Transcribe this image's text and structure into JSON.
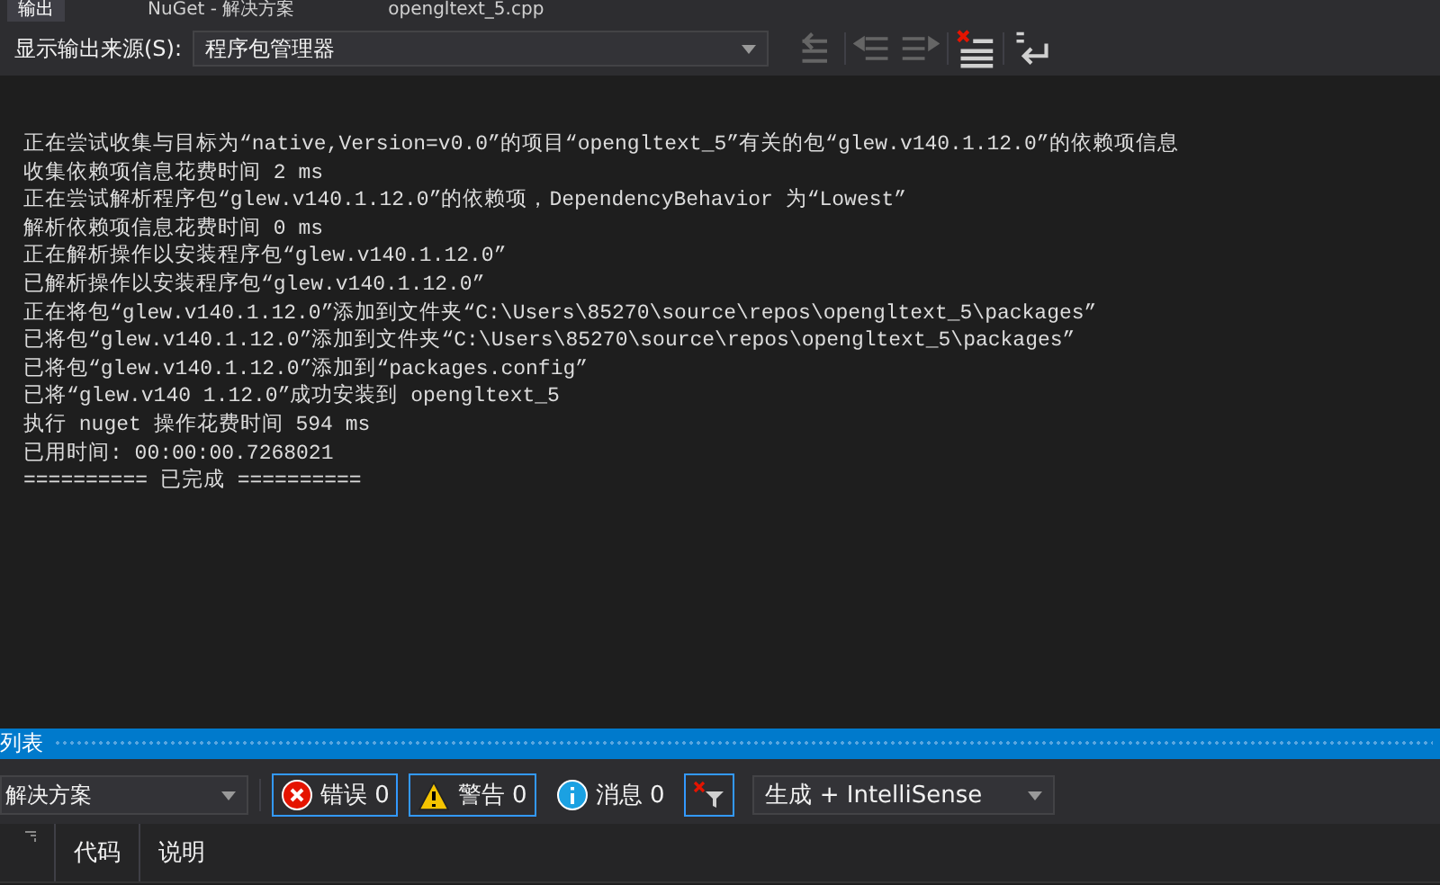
{
  "tabs": [
    {
      "label": "输出",
      "selected": true
    },
    {
      "label": "NuGet - 解决方案",
      "selected": false
    },
    {
      "label": "opengltext_5.cpp",
      "selected": false
    }
  ],
  "toolbar": {
    "source_label": "显示输出来源(S):",
    "source_value": "程序包管理器",
    "buttons": [
      {
        "kind": "goto",
        "disabled": true
      },
      {
        "kind": "prev",
        "disabled": true
      },
      {
        "kind": "next",
        "disabled": true
      },
      {
        "kind": "clear",
        "disabled": false
      },
      {
        "kind": "wrap",
        "disabled": false
      }
    ]
  },
  "output_lines": [
    "正在尝试收集与目标为“native,Version=v0.0”的项目“opengltext_5”有关的包“glew.v140.1.12.0”的依赖项信息",
    "收集依赖项信息花费时间 2 ms",
    "正在尝试解析程序包“glew.v140.1.12.0”的依赖项，DependencyBehavior 为“Lowest”",
    "解析依赖项信息花费时间 0 ms",
    "正在解析操作以安装程序包“glew.v140.1.12.0”",
    "已解析操作以安装程序包“glew.v140.1.12.0”",
    "正在将包“glew.v140.1.12.0”添加到文件夹“C:\\Users\\85270\\source\\repos\\opengltext_5\\packages”",
    "已将包“glew.v140.1.12.0”添加到文件夹“C:\\Users\\85270\\source\\repos\\opengltext_5\\packages”",
    "已将包“glew.v140.1.12.0”添加到“packages.config”",
    "已将“glew.v140 1.12.0”成功安装到 opengltext_5",
    "执行 nuget 操作花费时间 594 ms",
    "已用时间: 00:00:00.7268021",
    "========== 已完成 =========="
  ],
  "error_list": {
    "title": "列表",
    "scope": "解决方案",
    "toggles": [
      {
        "kind": "error",
        "label": "错误 0",
        "selected": true
      },
      {
        "kind": "warning",
        "label": "警告 0",
        "selected": true
      },
      {
        "kind": "message",
        "label": "消息 0",
        "selected": false
      },
      {
        "kind": "filter",
        "selected": true
      }
    ],
    "build_filter": "生成 + IntelliSense",
    "columns": [
      "代码",
      "说明"
    ]
  }
}
